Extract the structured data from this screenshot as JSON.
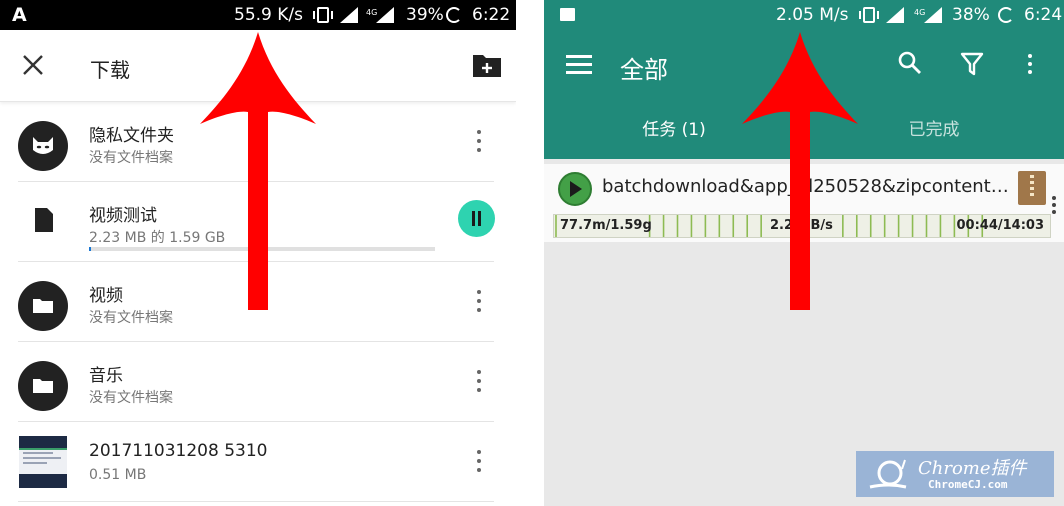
{
  "left_phone": {
    "status_bar": {
      "app_letter": "A",
      "net_speed": "55.9 K/s",
      "battery": "39%",
      "time": "6:22"
    },
    "toolbar": {
      "title": "下载",
      "close_icon": "close-icon",
      "new_folder_icon": "create-new-folder-icon"
    },
    "items": [
      {
        "name": "隐私文件夹",
        "subtitle": "没有文件档案",
        "icon": "private-folder-cat-icon"
      },
      {
        "name": "视频测试",
        "subtitle": "2.23 MB 的 1.59 GB",
        "icon": "file-icon",
        "progress": 0.0014,
        "action_icon": "pause-icon"
      },
      {
        "name": "视频",
        "subtitle": "没有文件档案",
        "icon": "folder-icon"
      },
      {
        "name": "音乐",
        "subtitle": "没有文件档案",
        "icon": "folder-icon"
      },
      {
        "name": "201711031208 5310",
        "subtitle": "0.51 MB",
        "icon": "image-thumbnail"
      }
    ]
  },
  "right_phone": {
    "status_bar": {
      "net_speed": "2.05 M/s",
      "battery": "38%",
      "time": "6:24"
    },
    "toolbar": {
      "title": "全部",
      "menu_icon": "hamburger-menu-icon",
      "search_icon": "search-icon",
      "filter_icon": "filter-icon",
      "more_icon": "more-vert-icon"
    },
    "tabs": [
      {
        "label": "任务 (1)",
        "active": true
      },
      {
        "label": "已完成",
        "active": false
      }
    ],
    "task": {
      "file_name": "batchdownload&app_id250528&zipcontent…",
      "downloaded": "77.7m/1.59g",
      "speed": "2.2 MB/s",
      "time": "00:44/14:03",
      "status_icon": "play-icon",
      "file_type_icon": "zip-archive-icon"
    }
  },
  "watermark": {
    "line1": "Chrome插件",
    "line2": "ChromeCJ.com"
  },
  "colors": {
    "teal_header": "#208a7a",
    "arrow_red": "#ff0000",
    "pause_button": "#2ed3b0",
    "play_button": "#43a047"
  }
}
